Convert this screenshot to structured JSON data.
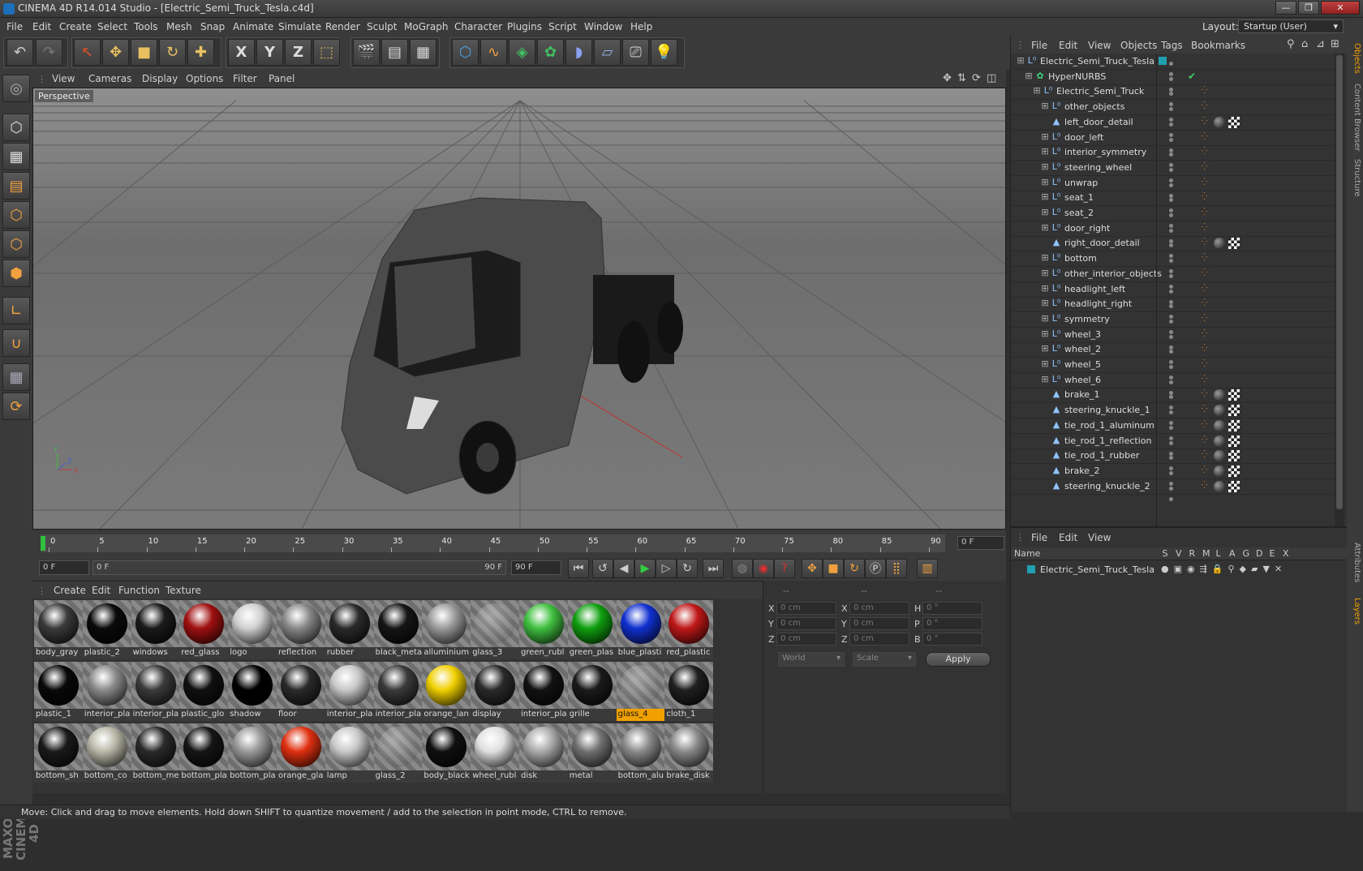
{
  "window": {
    "title": "CINEMA 4D R14.014 Studio - [Electric_Semi_Truck_Tesla.c4d]",
    "controls": [
      "—",
      "❐",
      "✕"
    ]
  },
  "menubar": {
    "items": [
      "File",
      "Edit",
      "Create",
      "Select",
      "Tools",
      "Mesh",
      "Snap",
      "Animate",
      "Simulate",
      "Render",
      "Sculpt",
      "MoGraph",
      "Character",
      "Plugins",
      "Script",
      "Window",
      "Help"
    ],
    "layout_label": "Layout:",
    "layout_value": "Startup (User)"
  },
  "toolbar": {
    "icons": [
      "undo-icon",
      "redo-icon",
      "live-select-icon",
      "move-icon",
      "scale-icon",
      "rotate-icon",
      "recent-tool-icon",
      "x-axis-icon",
      "y-axis-icon",
      "z-axis-icon",
      "coordinate-system-icon",
      "render-view-icon",
      "render-picture-viewer-icon",
      "render-settings-icon",
      "cube-icon",
      "spline-pen-icon",
      "nurbs-icon",
      "array-icon",
      "deformer-icon",
      "floor-icon",
      "camera-icon",
      "light-icon"
    ],
    "axis_labels": [
      "X",
      "Y",
      "Z"
    ]
  },
  "left_tools": {
    "icons": [
      "make-editable-icon",
      "model-mode-icon",
      "texture-mode-icon",
      "workplane-icon",
      "points-mode-icon",
      "edges-mode-icon",
      "polygons-mode-icon",
      "axis-mode-icon",
      "magnet-icon",
      "snap-grid-icon",
      "animate-mode-icon"
    ],
    "brand": "MAXON CINEMA 4D"
  },
  "viewport": {
    "menu": [
      "View",
      "Cameras",
      "Display",
      "Options",
      "Filter",
      "Panel"
    ],
    "label": "Perspective",
    "axis": {
      "x": "X",
      "y": "Y",
      "z": "Z"
    }
  },
  "timeline": {
    "ticks": [
      "0",
      "5",
      "10",
      "15",
      "20",
      "25",
      "30",
      "35",
      "40",
      "45",
      "50",
      "55",
      "60",
      "65",
      "70",
      "75",
      "80",
      "85",
      "90"
    ],
    "current_frame": "0 F",
    "start_field": "0 F",
    "range_start": "0 F",
    "range_end": "90 F",
    "end_field": "90 F",
    "playhead_frame": 0,
    "total_frames": 90
  },
  "materials": {
    "menu": [
      "Create",
      "Edit",
      "Function",
      "Texture"
    ],
    "items": [
      {
        "label": "body_gray",
        "color": "#3a3a3a"
      },
      {
        "label": "plastic_2",
        "color": "#0a0a0a"
      },
      {
        "label": "windows",
        "color": "#1a1a1a"
      },
      {
        "label": "red_glass",
        "color": "#a01010"
      },
      {
        "label": "logo",
        "color": "#d0d0d0"
      },
      {
        "label": "reflection",
        "color": "#888888"
      },
      {
        "label": "rubber",
        "color": "#2a2a2a"
      },
      {
        "label": "black_meta",
        "color": "#151515"
      },
      {
        "label": "alluminium",
        "color": "#9a9a9a"
      },
      {
        "label": "glass_3",
        "color": ""
      },
      {
        "label": "green_rubl",
        "color": "#40c040"
      },
      {
        "label": "green_plas",
        "color": "#10a010"
      },
      {
        "label": "blue_plasti",
        "color": "#1030d0"
      },
      {
        "label": "red_plastic",
        "color": "#c01818"
      },
      {
        "label": "plastic_1",
        "color": "#080808"
      },
      {
        "label": "interior_pla",
        "color": "#8a8a8a"
      },
      {
        "label": "interior_pla",
        "color": "#3a3a3a"
      },
      {
        "label": "plastic_glo",
        "color": "#101010"
      },
      {
        "label": "shadow",
        "color": "#000000"
      },
      {
        "label": "floor",
        "color": "#2a2a2a"
      },
      {
        "label": "interior_pla",
        "color": "#c8c8c8"
      },
      {
        "label": "interior_pla",
        "color": "#3a3a3a"
      },
      {
        "label": "orange_lan",
        "color": "#f0d000"
      },
      {
        "label": "display",
        "color": "#2a2a2a"
      },
      {
        "label": "interior_pla",
        "color": "#121212"
      },
      {
        "label": "grille",
        "color": "#1a1a1a"
      },
      {
        "label": "glass_4",
        "color": "",
        "selected": true
      },
      {
        "label": "cloth_1",
        "color": "#202020"
      },
      {
        "label": "bottom_sh",
        "color": "#1a1a1a"
      },
      {
        "label": "bottom_co",
        "color": "#b8b8a8"
      },
      {
        "label": "bottom_me",
        "color": "#2a2a2a"
      },
      {
        "label": "bottom_pla",
        "color": "#151515"
      },
      {
        "label": "bottom_pla",
        "color": "#9a9a9a"
      },
      {
        "label": "orange_gla",
        "color": "#e03010"
      },
      {
        "label": "lamp",
        "color": "#c8c8c8"
      },
      {
        "label": "glass_2",
        "color": ""
      },
      {
        "label": "body_black",
        "color": "#101010"
      },
      {
        "label": "wheel_rubl",
        "color": "#e0e0e0"
      },
      {
        "label": "disk",
        "color": "#aaaaaa"
      },
      {
        "label": "metal",
        "color": "#707070"
      },
      {
        "label": "bottom_alu",
        "color": "#8a8a8a"
      },
      {
        "label": "brake_disk",
        "color": "#8a8a8a"
      }
    ]
  },
  "coordinates": {
    "headers": [
      "--",
      "--",
      "--"
    ],
    "rows": [
      {
        "a": "X",
        "av": "0 cm",
        "b": "X",
        "bv": "0 cm",
        "c": "H",
        "cv": "0 °"
      },
      {
        "a": "Y",
        "av": "0 cm",
        "b": "Y",
        "bv": "0 cm",
        "c": "P",
        "cv": "0 °"
      },
      {
        "a": "Z",
        "av": "0 cm",
        "b": "Z",
        "bv": "0 cm",
        "c": "B",
        "cv": "0 °"
      }
    ],
    "world": "World",
    "scale": "Scale",
    "apply": "Apply"
  },
  "status": "Move: Click and drag to move elements. Hold down SHIFT to quantize movement / add to the selection in point mode, CTRL to remove.",
  "objects": {
    "menu": [
      "File",
      "Edit",
      "View",
      "Objects",
      "Tags",
      "Bookmarks"
    ],
    "rows": [
      {
        "name": "Electric_Semi_Truck_Tesla",
        "indent": 0,
        "kind": "null",
        "tags": []
      },
      {
        "name": "HyperNURBS",
        "indent": 1,
        "kind": "nurbs",
        "tags": []
      },
      {
        "name": "Electric_Semi_Truck",
        "indent": 2,
        "kind": "null",
        "tags": []
      },
      {
        "name": "other_objects",
        "indent": 3,
        "kind": "null",
        "tags": []
      },
      {
        "name": "left_door_detail",
        "indent": 3,
        "kind": "poly",
        "tags": [
          "ball",
          "check"
        ]
      },
      {
        "name": "door_left",
        "indent": 3,
        "kind": "null",
        "tags": []
      },
      {
        "name": "interior_symmetry",
        "indent": 3,
        "kind": "null",
        "tags": []
      },
      {
        "name": "steering_wheel",
        "indent": 3,
        "kind": "null",
        "tags": []
      },
      {
        "name": "unwrap",
        "indent": 3,
        "kind": "null",
        "tags": []
      },
      {
        "name": "seat_1",
        "indent": 3,
        "kind": "null",
        "tags": []
      },
      {
        "name": "seat_2",
        "indent": 3,
        "kind": "null",
        "tags": []
      },
      {
        "name": "door_right",
        "indent": 3,
        "kind": "null",
        "tags": []
      },
      {
        "name": "right_door_detail",
        "indent": 3,
        "kind": "poly",
        "tags": [
          "ball",
          "check"
        ]
      },
      {
        "name": "bottom",
        "indent": 3,
        "kind": "null",
        "tags": []
      },
      {
        "name": "other_interior_objects",
        "indent": 3,
        "kind": "null",
        "tags": []
      },
      {
        "name": "headlight_left",
        "indent": 3,
        "kind": "null",
        "tags": []
      },
      {
        "name": "headlight_right",
        "indent": 3,
        "kind": "null",
        "tags": []
      },
      {
        "name": "symmetry",
        "indent": 3,
        "kind": "null",
        "tags": []
      },
      {
        "name": "wheel_3",
        "indent": 3,
        "kind": "null",
        "tags": []
      },
      {
        "name": "wheel_2",
        "indent": 3,
        "kind": "null",
        "tags": []
      },
      {
        "name": "wheel_5",
        "indent": 3,
        "kind": "null",
        "tags": []
      },
      {
        "name": "wheel_6",
        "indent": 3,
        "kind": "null",
        "tags": []
      },
      {
        "name": "brake_1",
        "indent": 3,
        "kind": "poly",
        "tags": [
          "ball",
          "check"
        ]
      },
      {
        "name": "steering_knuckle_1",
        "indent": 3,
        "kind": "poly",
        "tags": [
          "ball",
          "check"
        ]
      },
      {
        "name": "tie_rod_1_aluminum",
        "indent": 3,
        "kind": "poly",
        "tags": [
          "ball",
          "check"
        ]
      },
      {
        "name": "tie_rod_1_reflection",
        "indent": 3,
        "kind": "poly",
        "tags": [
          "ball",
          "check"
        ]
      },
      {
        "name": "tie_rod_1_rubber",
        "indent": 3,
        "kind": "poly",
        "tags": [
          "ball",
          "check"
        ]
      },
      {
        "name": "brake_2",
        "indent": 3,
        "kind": "poly",
        "tags": [
          "ball",
          "check"
        ]
      },
      {
        "name": "steering_knuckle_2",
        "indent": 3,
        "kind": "poly",
        "tags": [
          "ball",
          "check"
        ]
      }
    ]
  },
  "layers": {
    "menu": [
      "File",
      "Edit",
      "View"
    ],
    "columns": [
      "Name",
      "S",
      "V",
      "R",
      "M",
      "L",
      "A",
      "G",
      "D",
      "E",
      "X"
    ],
    "rows": [
      {
        "name": "Electric_Semi_Truck_Tesla",
        "color": "#20a0b0"
      }
    ]
  },
  "right_tabs": [
    "Objects",
    "Content Browser",
    "Structure",
    "Attributes",
    "Layers"
  ]
}
